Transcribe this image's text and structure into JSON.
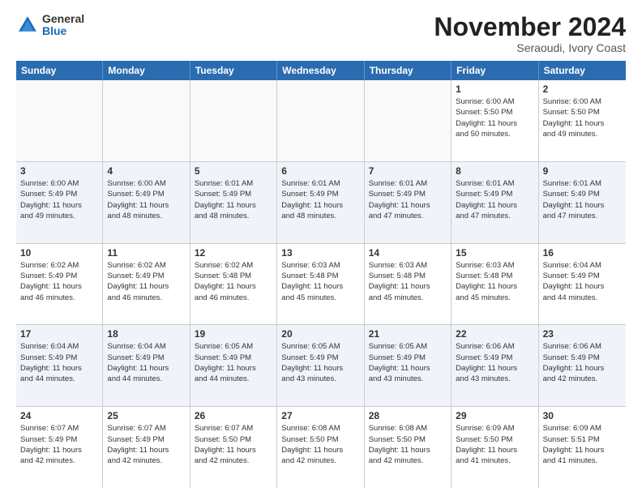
{
  "logo": {
    "general": "General",
    "blue": "Blue"
  },
  "title": "November 2024",
  "subtitle": "Seraoudi, Ivory Coast",
  "days_header": [
    "Sunday",
    "Monday",
    "Tuesday",
    "Wednesday",
    "Thursday",
    "Friday",
    "Saturday"
  ],
  "weeks": [
    [
      {
        "day": "",
        "info": "",
        "empty": true
      },
      {
        "day": "",
        "info": "",
        "empty": true
      },
      {
        "day": "",
        "info": "",
        "empty": true
      },
      {
        "day": "",
        "info": "",
        "empty": true
      },
      {
        "day": "",
        "info": "",
        "empty": true
      },
      {
        "day": "1",
        "info": "Sunrise: 6:00 AM\nSunset: 5:50 PM\nDaylight: 11 hours\nand 50 minutes."
      },
      {
        "day": "2",
        "info": "Sunrise: 6:00 AM\nSunset: 5:50 PM\nDaylight: 11 hours\nand 49 minutes."
      }
    ],
    [
      {
        "day": "3",
        "info": "Sunrise: 6:00 AM\nSunset: 5:49 PM\nDaylight: 11 hours\nand 49 minutes."
      },
      {
        "day": "4",
        "info": "Sunrise: 6:00 AM\nSunset: 5:49 PM\nDaylight: 11 hours\nand 48 minutes."
      },
      {
        "day": "5",
        "info": "Sunrise: 6:01 AM\nSunset: 5:49 PM\nDaylight: 11 hours\nand 48 minutes."
      },
      {
        "day": "6",
        "info": "Sunrise: 6:01 AM\nSunset: 5:49 PM\nDaylight: 11 hours\nand 48 minutes."
      },
      {
        "day": "7",
        "info": "Sunrise: 6:01 AM\nSunset: 5:49 PM\nDaylight: 11 hours\nand 47 minutes."
      },
      {
        "day": "8",
        "info": "Sunrise: 6:01 AM\nSunset: 5:49 PM\nDaylight: 11 hours\nand 47 minutes."
      },
      {
        "day": "9",
        "info": "Sunrise: 6:01 AM\nSunset: 5:49 PM\nDaylight: 11 hours\nand 47 minutes."
      }
    ],
    [
      {
        "day": "10",
        "info": "Sunrise: 6:02 AM\nSunset: 5:49 PM\nDaylight: 11 hours\nand 46 minutes."
      },
      {
        "day": "11",
        "info": "Sunrise: 6:02 AM\nSunset: 5:49 PM\nDaylight: 11 hours\nand 46 minutes."
      },
      {
        "day": "12",
        "info": "Sunrise: 6:02 AM\nSunset: 5:48 PM\nDaylight: 11 hours\nand 46 minutes."
      },
      {
        "day": "13",
        "info": "Sunrise: 6:03 AM\nSunset: 5:48 PM\nDaylight: 11 hours\nand 45 minutes."
      },
      {
        "day": "14",
        "info": "Sunrise: 6:03 AM\nSunset: 5:48 PM\nDaylight: 11 hours\nand 45 minutes."
      },
      {
        "day": "15",
        "info": "Sunrise: 6:03 AM\nSunset: 5:48 PM\nDaylight: 11 hours\nand 45 minutes."
      },
      {
        "day": "16",
        "info": "Sunrise: 6:04 AM\nSunset: 5:49 PM\nDaylight: 11 hours\nand 44 minutes."
      }
    ],
    [
      {
        "day": "17",
        "info": "Sunrise: 6:04 AM\nSunset: 5:49 PM\nDaylight: 11 hours\nand 44 minutes."
      },
      {
        "day": "18",
        "info": "Sunrise: 6:04 AM\nSunset: 5:49 PM\nDaylight: 11 hours\nand 44 minutes."
      },
      {
        "day": "19",
        "info": "Sunrise: 6:05 AM\nSunset: 5:49 PM\nDaylight: 11 hours\nand 44 minutes."
      },
      {
        "day": "20",
        "info": "Sunrise: 6:05 AM\nSunset: 5:49 PM\nDaylight: 11 hours\nand 43 minutes."
      },
      {
        "day": "21",
        "info": "Sunrise: 6:05 AM\nSunset: 5:49 PM\nDaylight: 11 hours\nand 43 minutes."
      },
      {
        "day": "22",
        "info": "Sunrise: 6:06 AM\nSunset: 5:49 PM\nDaylight: 11 hours\nand 43 minutes."
      },
      {
        "day": "23",
        "info": "Sunrise: 6:06 AM\nSunset: 5:49 PM\nDaylight: 11 hours\nand 42 minutes."
      }
    ],
    [
      {
        "day": "24",
        "info": "Sunrise: 6:07 AM\nSunset: 5:49 PM\nDaylight: 11 hours\nand 42 minutes."
      },
      {
        "day": "25",
        "info": "Sunrise: 6:07 AM\nSunset: 5:49 PM\nDaylight: 11 hours\nand 42 minutes."
      },
      {
        "day": "26",
        "info": "Sunrise: 6:07 AM\nSunset: 5:50 PM\nDaylight: 11 hours\nand 42 minutes."
      },
      {
        "day": "27",
        "info": "Sunrise: 6:08 AM\nSunset: 5:50 PM\nDaylight: 11 hours\nand 42 minutes."
      },
      {
        "day": "28",
        "info": "Sunrise: 6:08 AM\nSunset: 5:50 PM\nDaylight: 11 hours\nand 42 minutes."
      },
      {
        "day": "29",
        "info": "Sunrise: 6:09 AM\nSunset: 5:50 PM\nDaylight: 11 hours\nand 41 minutes."
      },
      {
        "day": "30",
        "info": "Sunrise: 6:09 AM\nSunset: 5:51 PM\nDaylight: 11 hours\nand 41 minutes."
      }
    ]
  ]
}
